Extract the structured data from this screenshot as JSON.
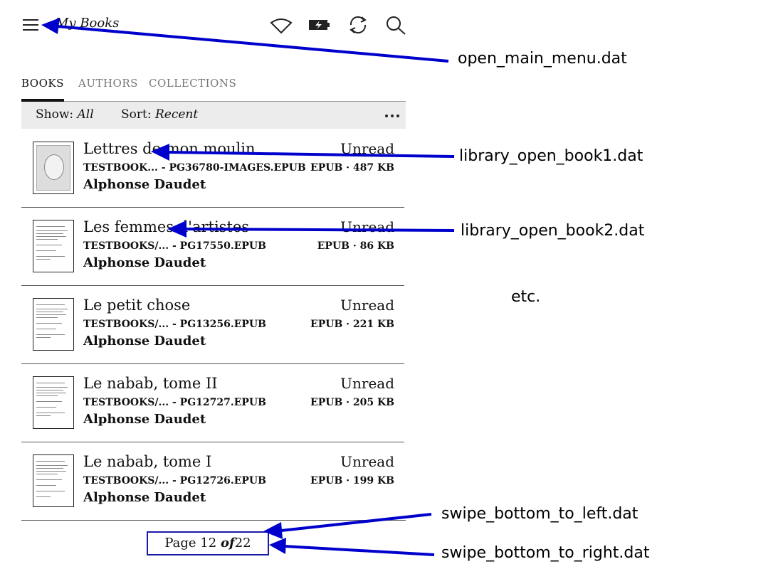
{
  "header": {
    "title": "My Books",
    "icons": [
      "menu-icon",
      "wifi-icon",
      "battery-charging-icon",
      "sync-icon",
      "search-icon"
    ]
  },
  "tabs": [
    {
      "label": "BOOKS",
      "active": true
    },
    {
      "label": "AUTHORS",
      "active": false
    },
    {
      "label": "COLLECTIONS",
      "active": false
    }
  ],
  "filter": {
    "show_label": "Show:",
    "show_value": "All",
    "sort_label": "Sort:",
    "sort_value": "Recent"
  },
  "books": [
    {
      "title": "Lettres de mon moulin",
      "path": "TESTBOOK... - PG36780-IMAGES.EPUB",
      "author": "Alphonse Daudet",
      "status": "Unread",
      "meta": "EPUB · 487 KB"
    },
    {
      "title": "Les femmes d'artistes",
      "path": "TESTBOOKS/... - PG17550.EPUB",
      "author": "Alphonse Daudet",
      "status": "Unread",
      "meta": "EPUB · 86 KB"
    },
    {
      "title": "Le petit chose",
      "path": "TESTBOOKS/... - PG13256.EPUB",
      "author": "Alphonse Daudet",
      "status": "Unread",
      "meta": "EPUB · 221 KB"
    },
    {
      "title": "Le nabab, tome II",
      "path": "TESTBOOKS/... - PG12727.EPUB",
      "author": "Alphonse Daudet",
      "status": "Unread",
      "meta": "EPUB · 205 KB"
    },
    {
      "title": "Le nabab, tome I",
      "path": "TESTBOOKS/... - PG12726.EPUB",
      "author": "Alphonse Daudet",
      "status": "Unread",
      "meta": "EPUB · 199 KB"
    }
  ],
  "pager": {
    "prefix": "Page",
    "current": "12",
    "of": "of",
    "total": "22"
  },
  "annotations": {
    "menu": "open_main_menu.dat",
    "book1": "library_open_book1.dat",
    "book2": "library_open_book2.dat",
    "etc": "etc.",
    "swipe_left": "swipe_bottom_to_left.dat",
    "swipe_right": "swipe_bottom_to_right.dat",
    "arrow_color": "#0000cc"
  }
}
